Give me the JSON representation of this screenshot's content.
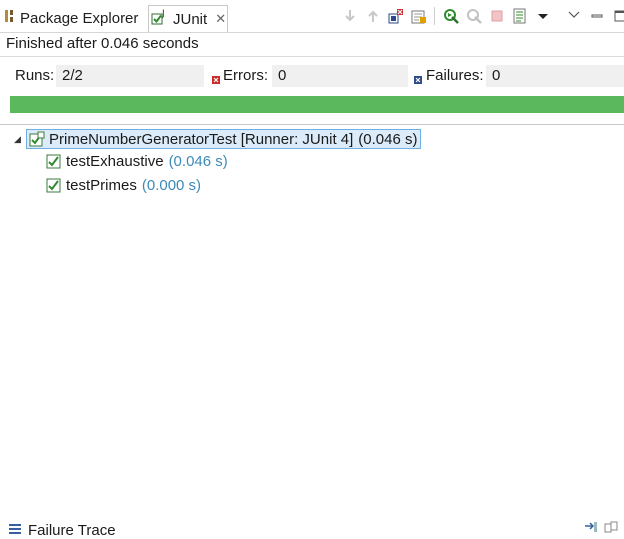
{
  "tabs": [
    {
      "label": "Package Explorer",
      "icon": "package-explorer-icon",
      "active": false
    },
    {
      "label": "JUnit",
      "icon": "junit-icon",
      "active": true
    }
  ],
  "status": "Finished after 0.046 seconds",
  "counters": {
    "runs_label": "Runs:",
    "runs_value": "2/2",
    "errors_label": "Errors:",
    "errors_value": "0",
    "failures_label": "Failures:",
    "failures_value": "0"
  },
  "progress": {
    "fraction": 1.0,
    "color": "#5cb85c"
  },
  "tree": {
    "root": {
      "label": "PrimeNumberGeneratorTest [Runner: JUnit 4]",
      "time": "(0.046 s)"
    },
    "children": [
      {
        "label": "testExhaustive",
        "time": "(0.046 s)"
      },
      {
        "label": "testPrimes",
        "time": "(0.000 s)"
      }
    ]
  },
  "failure_trace": {
    "label": "Failure Trace"
  },
  "colors": {
    "success": "#5cb85c",
    "error": "#cc2a2a",
    "failure": "#2a4a8c",
    "time": "#3d8ab8"
  }
}
